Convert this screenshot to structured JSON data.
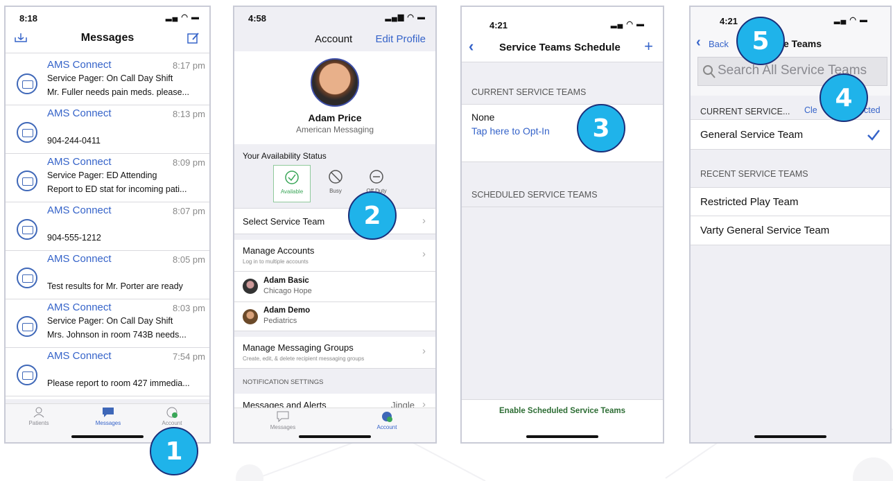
{
  "phone1": {
    "time": "8:18",
    "title": "Messages",
    "messages": [
      {
        "from": "AMS Connect",
        "time": "8:17 pm",
        "line1": "Service Pager: On Call Day Shift",
        "line2": "Mr. Fuller needs pain meds. please..."
      },
      {
        "from": "AMS Connect",
        "time": "8:13 pm",
        "line1": "",
        "line2": "904-244-0411"
      },
      {
        "from": "AMS Connect",
        "time": "8:09 pm",
        "line1": "Service Pager: ED Attending",
        "line2": "Report to ED stat for incoming pati..."
      },
      {
        "from": "AMS Connect",
        "time": "8:07 pm",
        "line1": "",
        "line2": "904-555-1212"
      },
      {
        "from": "AMS Connect",
        "time": "8:05 pm",
        "line1": "",
        "line2": "Test results for Mr. Porter are ready"
      },
      {
        "from": "AMS Connect",
        "time": "8:03 pm",
        "line1": "Service Pager: On Call Day Shift",
        "line2": "Mrs. Johnson in room 743B needs..."
      },
      {
        "from": "AMS Connect",
        "time": "7:54 pm",
        "line1": "",
        "line2": "Please report to room 427 immedia..."
      }
    ],
    "tabs": {
      "patients": "Patients",
      "messages": "Messages",
      "account": "Account"
    }
  },
  "phone2": {
    "time": "4:58",
    "title": "Account",
    "edit_profile": "Edit Profile",
    "name": "Adam Price",
    "org": "American Messaging",
    "availability_header": "Your Availability Status",
    "status": {
      "available": "Available",
      "busy": "Busy",
      "off_duty": "Off Duty"
    },
    "select_team": "Select Service Team",
    "manage_accounts": "Manage Accounts",
    "manage_accounts_sub": "Log in to multiple accounts",
    "accounts": [
      {
        "name": "Adam Basic",
        "org": "Chicago Hope"
      },
      {
        "name": "Adam Demo",
        "org": "Pediatrics"
      }
    ],
    "manage_groups": "Manage Messaging Groups",
    "manage_groups_sub": "Create, edit, & delete recipient messaging groups",
    "notification_header": "NOTIFICATION SETTINGS",
    "messages_alerts": "Messages and Alerts",
    "messages_alerts_value": "Jingle",
    "tabs": {
      "messages": "Messages",
      "account": "Account"
    }
  },
  "phone3": {
    "time": "4:21",
    "title": "Service Teams Schedule",
    "current_header": "CURRENT SERVICE TEAMS",
    "none": "None",
    "opt_in": "Tap here to Opt-In",
    "scheduled_header": "SCHEDULED SERVICE TEAMS",
    "enable": "Enable Scheduled Service Teams"
  },
  "phone4": {
    "time": "4:21",
    "back": "Back",
    "title_fragment": "e Teams",
    "search_placeholder": "Search All Service Teams",
    "current_header": "CURRENT SERVICE...",
    "clear_a": "Cle",
    "clear_b": "cted",
    "current_team": "General Service Team",
    "recent_header": "RECENT SERVICE TEAMS",
    "recent": [
      "Restricted Play Team",
      "Varty General Service Team"
    ]
  },
  "callouts": [
    "1",
    "2",
    "3",
    "4",
    "5"
  ]
}
